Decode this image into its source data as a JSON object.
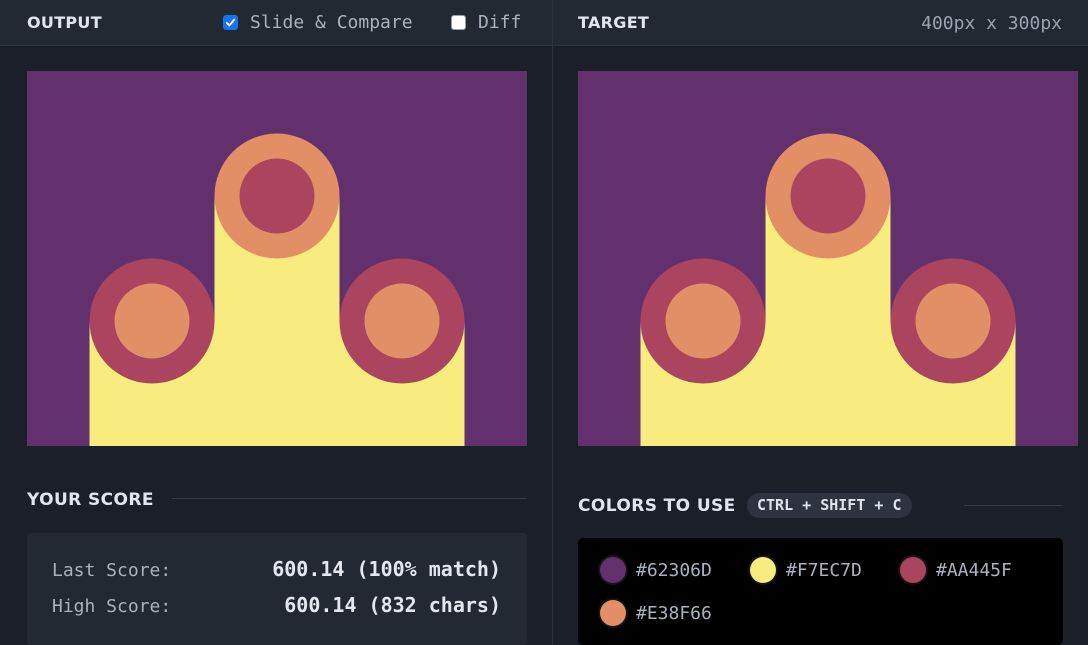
{
  "output": {
    "title": "OUTPUT",
    "slide_compare_label": "Slide & Compare",
    "slide_compare_checked": true,
    "diff_label": "Diff",
    "diff_checked": false
  },
  "target": {
    "title": "TARGET",
    "dimensions": "400px x 300px"
  },
  "score": {
    "title": "YOUR SCORE",
    "last_label": "Last Score:",
    "last_value": "600.14 (100% match)",
    "high_label": "High Score:",
    "high_value": "600.14 (832 chars)"
  },
  "colors": {
    "title": "COLORS TO USE",
    "shortcut": "CTRL + SHIFT + C",
    "swatches": [
      {
        "hex": "#62306D",
        "label": "#62306D"
      },
      {
        "hex": "#F7EC7D",
        "label": "#F7EC7D"
      },
      {
        "hex": "#AA445F",
        "label": "#AA445F"
      },
      {
        "hex": "#E38F66",
        "label": "#E38F66"
      }
    ]
  },
  "theme": {
    "background": "#1b1f27",
    "header": "#232932",
    "accent": "#1a73e8"
  }
}
